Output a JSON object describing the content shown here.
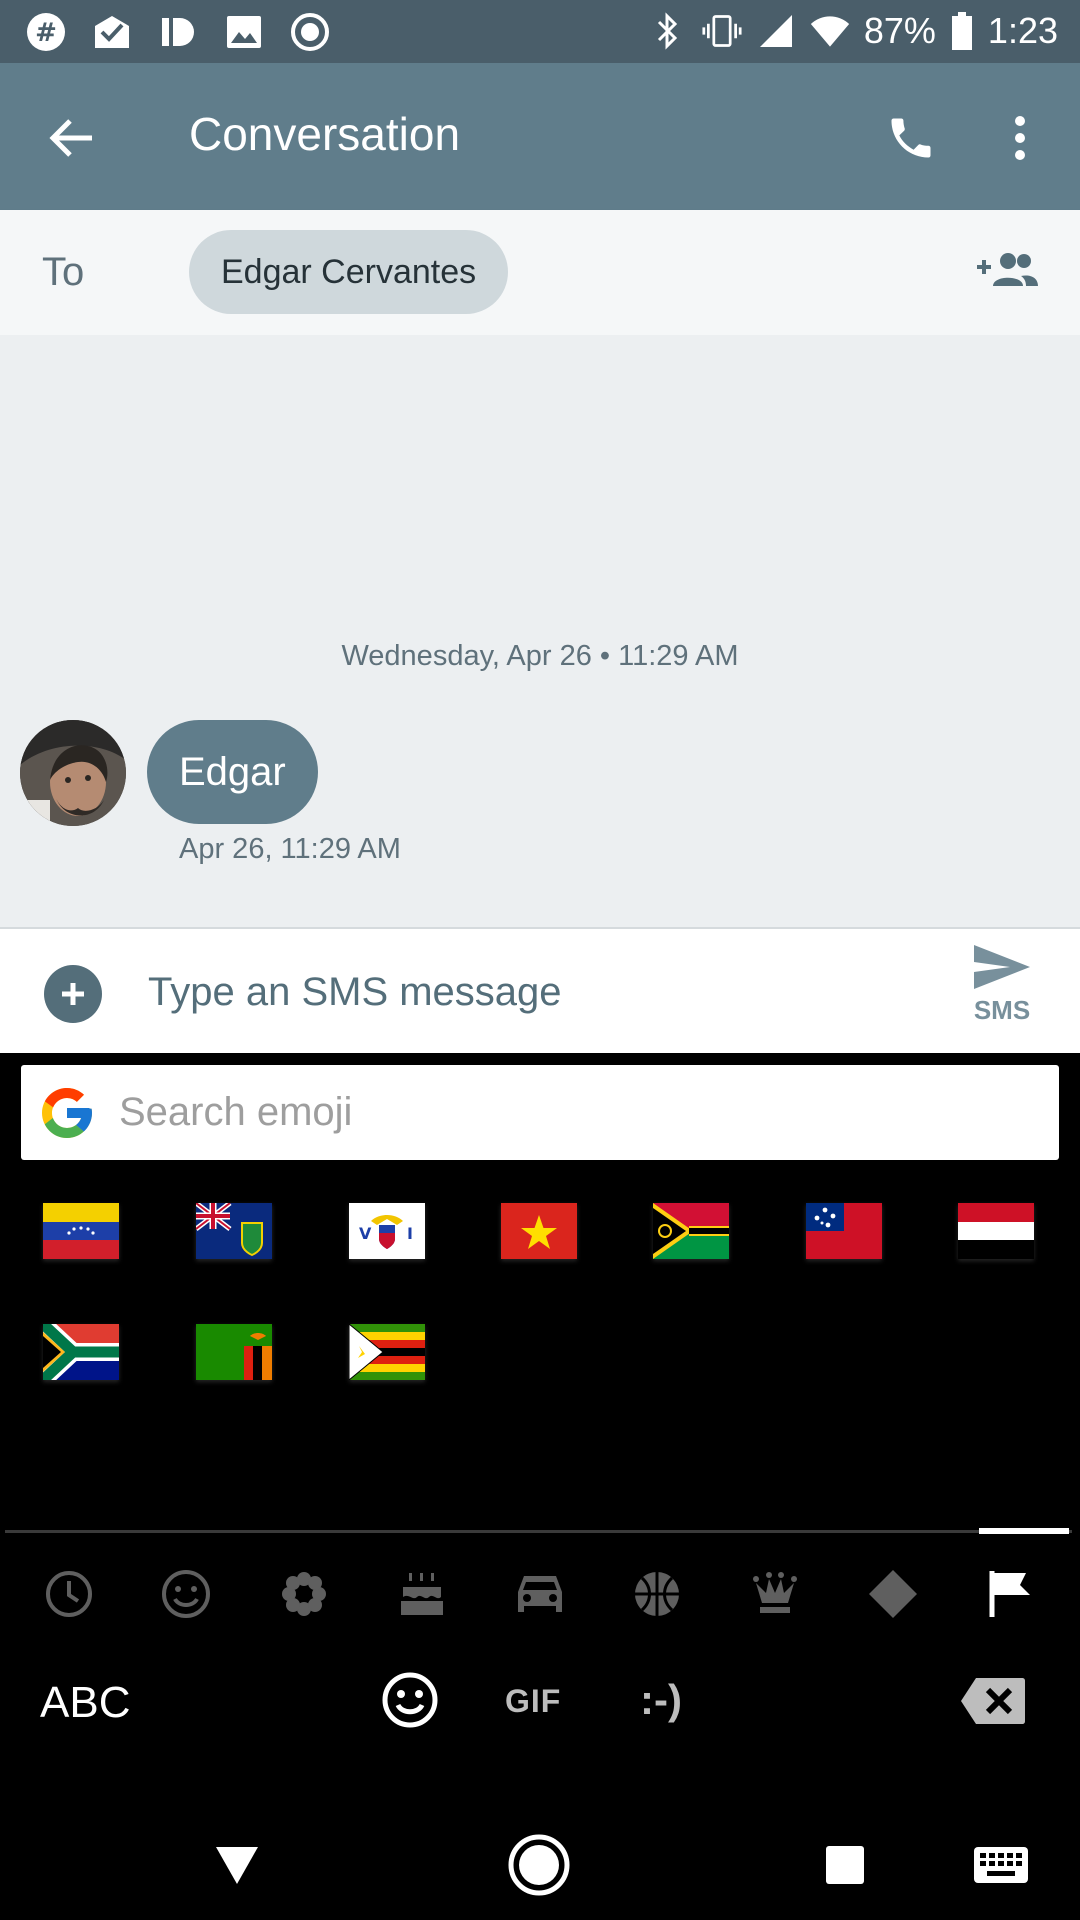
{
  "status_bar": {
    "battery": "87%",
    "time": "1:23",
    "left_icons": [
      "hashtag-app-icon",
      "mail-check-icon",
      "pushbullet-icon",
      "image-icon",
      "record-icon"
    ],
    "right_icons": [
      "bluetooth-icon",
      "vibrate-icon",
      "signal-icon",
      "wifi-icon",
      "battery-icon"
    ]
  },
  "app_bar": {
    "title": "Conversation",
    "back_icon": "arrow-back-icon",
    "actions": [
      "phone-icon",
      "more-vert-icon"
    ]
  },
  "recipients": {
    "label": "To",
    "chip": "Edgar Cervantes",
    "add_icon": "add-people-icon"
  },
  "conversation": {
    "date_separator": "Wednesday, Apr 26 • 11:29 AM",
    "messages": [
      {
        "text": "Edgar",
        "time": "Apr 26, 11:29 AM",
        "sender": "Edgar Cervantes"
      }
    ]
  },
  "compose": {
    "placeholder": "Type an SMS message",
    "send_label": "SMS"
  },
  "keyboard": {
    "search_placeholder": "Search emoji",
    "flags": [
      "Venezuela",
      "British Virgin Islands",
      "U.S. Virgin Islands",
      "Vietnam",
      "Vanuatu",
      "Samoa",
      "Yemen",
      "South Africa",
      "Zambia",
      "Zimbabwe"
    ],
    "categories": [
      "recent-icon",
      "smileys-icon",
      "nature-icon",
      "food-icon",
      "travel-icon",
      "activities-icon",
      "objects-icon",
      "symbols-icon",
      "flags-icon"
    ],
    "active_category": "flags-icon",
    "abc_label": "ABC",
    "gif_label": "GIF",
    "emoticon_label": ":-)"
  },
  "nav_bar": [
    "back-nav-icon",
    "home-nav-icon",
    "recents-nav-icon",
    "keyboard-switch-icon"
  ],
  "colors": {
    "status_bar": "#4a5e6a",
    "app_bar": "#607d8b",
    "bubble": "#607d8b",
    "conversation_bg": "#eceff1"
  }
}
